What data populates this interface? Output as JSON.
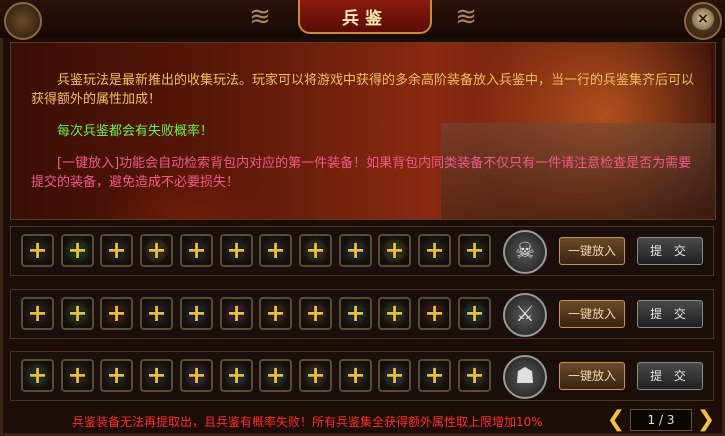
{
  "window": {
    "title": "兵鉴"
  },
  "info": {
    "p1": "兵鉴玩法是最新推出的收集玩法。玩家可以将游戏中获得的多余高阶装备放入兵鉴中，当一行的兵鉴集齐后可以获得额外的属性加成！",
    "p2": "每次兵鉴都会有失败概率！",
    "p3": "[一键放入]功能会自动检索背包内对应的第一件装备！如果背包内同类装备不仅只有一件请注意检查是否为需要提交的装备，避免造成不必要损失！"
  },
  "slot_plus": "+",
  "rows": [
    {
      "slots": 12,
      "emblem_icon": "demon-mask-icon",
      "emblem_glyph": "☠",
      "put_all_label": "一键放入",
      "submit_label": "提 交",
      "ghost_colors": [
        "#3a3a3a",
        "#2f6a3a",
        "#3a3a3a",
        "#6a5a2a",
        "#3a3a3a",
        "#3a3a3a",
        "#3a3a3a",
        "#5a5a3a",
        "#3a4a6a",
        "#6a6a2a",
        "#3a3a3a",
        "#3a3a3a"
      ]
    },
    {
      "slots": 12,
      "emblem_icon": "warrior-helm-icon",
      "emblem_glyph": "⚔",
      "put_all_label": "一键放入",
      "submit_label": "提 交",
      "ghost_colors": [
        "#4a2a3a",
        "#3a5a3a",
        "#6a2a2a",
        "#3a2a4a",
        "#2a3a6a",
        "#6a2a5a",
        "#5a3a2a",
        "#6a3a2a",
        "#2a4a5a",
        "#4a5a2a",
        "#6a2a2a",
        "#2a5a5a"
      ]
    },
    {
      "slots": 12,
      "emblem_icon": "skull-warlord-icon",
      "emblem_glyph": "☗",
      "put_all_label": "一键放入",
      "submit_label": "提 交",
      "ghost_colors": [
        "#3a5a4a",
        "#4a3a2a",
        "#3a3a3a",
        "#3a3a3a",
        "#5a3a7a",
        "#3a4a5a",
        "#4a4a4a",
        "#5a4a3a",
        "#4a3a3a",
        "#4a4a6a",
        "#3a3a3a",
        "#4a4a3a"
      ]
    }
  ],
  "footer": {
    "notice": "兵鉴装备无法再提取出，且兵鉴有概率失败！所有兵鉴集全获得额外属性取上限增加10%",
    "page": "1 / 3",
    "prev_glyph": "❮",
    "next_glyph": "❯"
  },
  "colors": {
    "accent_gold": "#e7c13a",
    "text_orange": "#f0c060",
    "text_green": "#6cf04a",
    "text_pink": "#f05a8a",
    "notice_red": "#ff2a2a"
  }
}
